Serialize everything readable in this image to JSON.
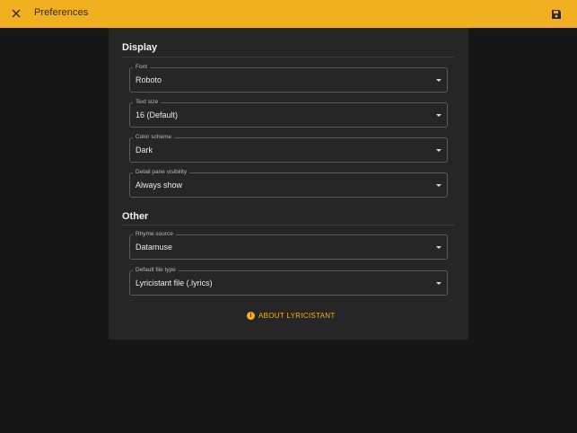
{
  "header": {
    "title": "Preferences",
    "close_icon": "close-icon",
    "save_icon": "save-icon"
  },
  "sections": {
    "display": {
      "title": "Display",
      "fields": [
        {
          "label": "Font",
          "value": "Roboto"
        },
        {
          "label": "Text size",
          "value": "16 (Default)"
        },
        {
          "label": "Color scheme",
          "value": "Dark"
        },
        {
          "label": "Detail pane visibility",
          "value": "Always show"
        }
      ]
    },
    "other": {
      "title": "Other",
      "fields": [
        {
          "label": "Rhyme source",
          "value": "Datamuse"
        },
        {
          "label": "Default file type",
          "value": "Lyricistant file (.lyrics)"
        }
      ]
    }
  },
  "about": {
    "label": "ABOUT LYRICISTANT",
    "icon": "info-icon"
  },
  "colors": {
    "accent": "#f0b020",
    "background": "#161616",
    "panel": "#262626"
  }
}
